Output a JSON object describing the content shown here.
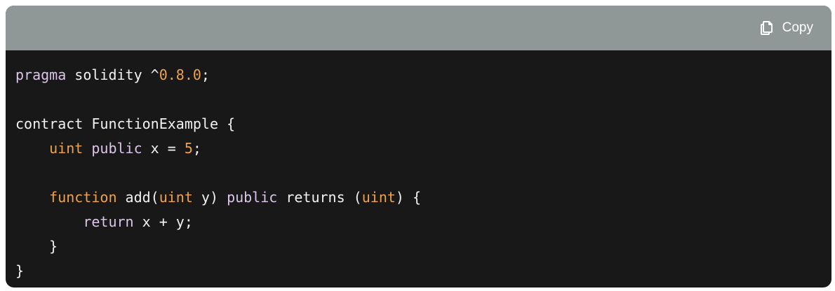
{
  "header": {
    "copy_label": "Copy"
  },
  "icons": {
    "copy": "copy-icon"
  },
  "colors": {
    "header_bg": "#8f9797",
    "code_bg": "#181818",
    "keyword": "#dcc5e9",
    "type_number": "#f0a14b",
    "plain": "#f2f2f2"
  },
  "code": {
    "language": "solidity",
    "lines": [
      [
        {
          "t": "kw",
          "v": "pragma"
        },
        {
          "t": "plain",
          "v": " solidity ^"
        },
        {
          "t": "num",
          "v": "0.8.0"
        },
        {
          "t": "plain",
          "v": ";"
        }
      ],
      [],
      [
        {
          "t": "plain",
          "v": "contract FunctionExample {"
        }
      ],
      [
        {
          "t": "plain",
          "v": "    "
        },
        {
          "t": "typ",
          "v": "uint"
        },
        {
          "t": "plain",
          "v": " "
        },
        {
          "t": "kw",
          "v": "public"
        },
        {
          "t": "plain",
          "v": " x = "
        },
        {
          "t": "num",
          "v": "5"
        },
        {
          "t": "plain",
          "v": ";"
        }
      ],
      [],
      [
        {
          "t": "plain",
          "v": "    "
        },
        {
          "t": "typ",
          "v": "function"
        },
        {
          "t": "plain",
          "v": " add("
        },
        {
          "t": "typ",
          "v": "uint"
        },
        {
          "t": "plain",
          "v": " y) "
        },
        {
          "t": "kw",
          "v": "public"
        },
        {
          "t": "plain",
          "v": " returns ("
        },
        {
          "t": "typ",
          "v": "uint"
        },
        {
          "t": "plain",
          "v": ") {"
        }
      ],
      [
        {
          "t": "plain",
          "v": "        "
        },
        {
          "t": "kw",
          "v": "return"
        },
        {
          "t": "plain",
          "v": " x + y;"
        }
      ],
      [
        {
          "t": "plain",
          "v": "    }"
        }
      ],
      [
        {
          "t": "plain",
          "v": "}"
        }
      ]
    ]
  }
}
